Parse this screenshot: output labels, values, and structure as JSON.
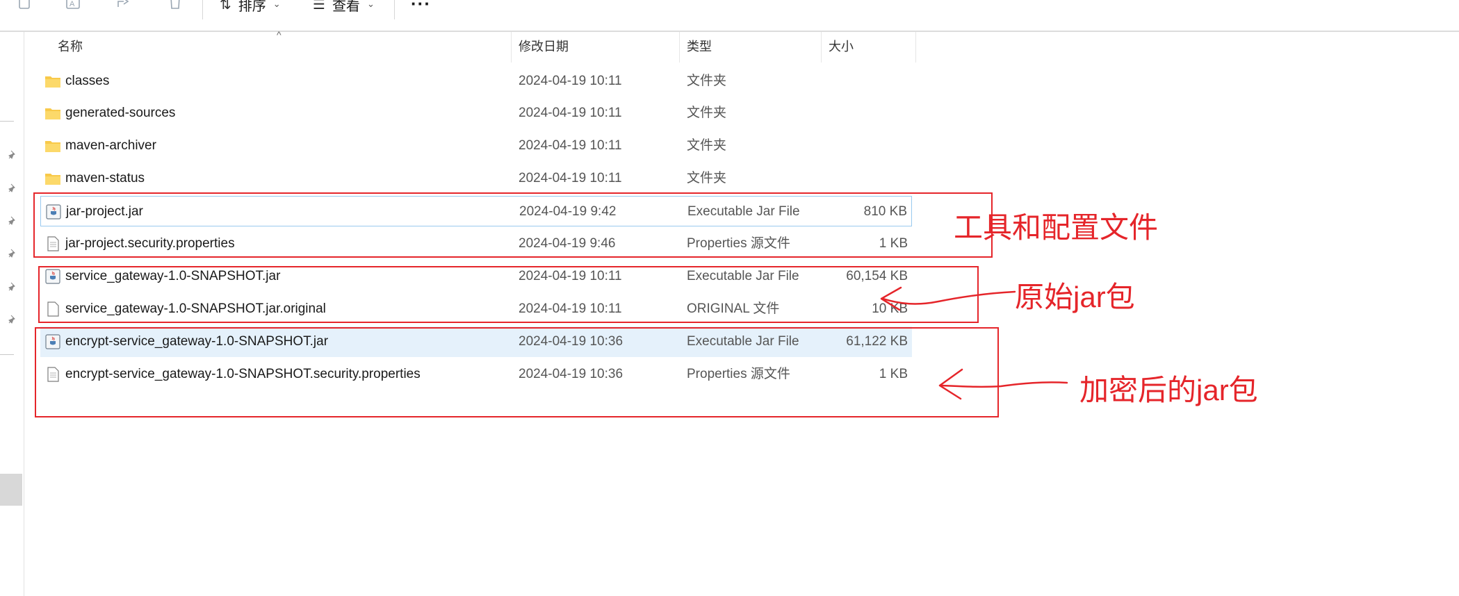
{
  "toolbar": {
    "sort_label": "排序",
    "view_label": "查看",
    "more_label": "···"
  },
  "columns": {
    "name": "名称",
    "modified": "修改日期",
    "type": "类型",
    "size": "大小"
  },
  "files": [
    {
      "name": "classes",
      "date": "2024-04-19 10:11",
      "type": "文件夹",
      "size": "",
      "icon": "folder-icon"
    },
    {
      "name": "generated-sources",
      "date": "2024-04-19 10:11",
      "type": "文件夹",
      "size": "",
      "icon": "folder-icon"
    },
    {
      "name": "maven-archiver",
      "date": "2024-04-19 10:11",
      "type": "文件夹",
      "size": "",
      "icon": "folder-icon"
    },
    {
      "name": "maven-status",
      "date": "2024-04-19 10:11",
      "type": "文件夹",
      "size": "",
      "icon": "folder-icon"
    },
    {
      "name": "jar-project.jar",
      "date": "2024-04-19 9:42",
      "type": "Executable Jar File",
      "size": "810 KB",
      "icon": "jar-file-icon"
    },
    {
      "name": "jar-project.security.properties",
      "date": "2024-04-19 9:46",
      "type": "Properties 源文件",
      "size": "1 KB",
      "icon": "document-icon"
    },
    {
      "name": "service_gateway-1.0-SNAPSHOT.jar",
      "date": "2024-04-19 10:11",
      "type": "Executable Jar File",
      "size": "60,154 KB",
      "icon": "jar-file-icon"
    },
    {
      "name": "service_gateway-1.0-SNAPSHOT.jar.original",
      "date": "2024-04-19 10:11",
      "type": "ORIGINAL 文件",
      "size": "10 KB",
      "icon": "document-icon"
    },
    {
      "name": "encrypt-service_gateway-1.0-SNAPSHOT.jar",
      "date": "2024-04-19 10:36",
      "type": "Executable Jar File",
      "size": "61,122 KB",
      "icon": "jar-file-icon"
    },
    {
      "name": "encrypt-service_gateway-1.0-SNAPSHOT.security.properties",
      "date": "2024-04-19 10:36",
      "type": "Properties 源文件",
      "size": "1 KB",
      "icon": "document-icon"
    }
  ],
  "annotations": {
    "tools_config": "工具和配置文件",
    "original_jar": "原始jar包",
    "encrypted_jar": "加密后的jar包"
  },
  "colors": {
    "annotation_red": "#e5252a",
    "selection_border": "#99c9ef",
    "highlight_bg": "#e5f1fb",
    "folder_yellow": "#f8c94a"
  }
}
